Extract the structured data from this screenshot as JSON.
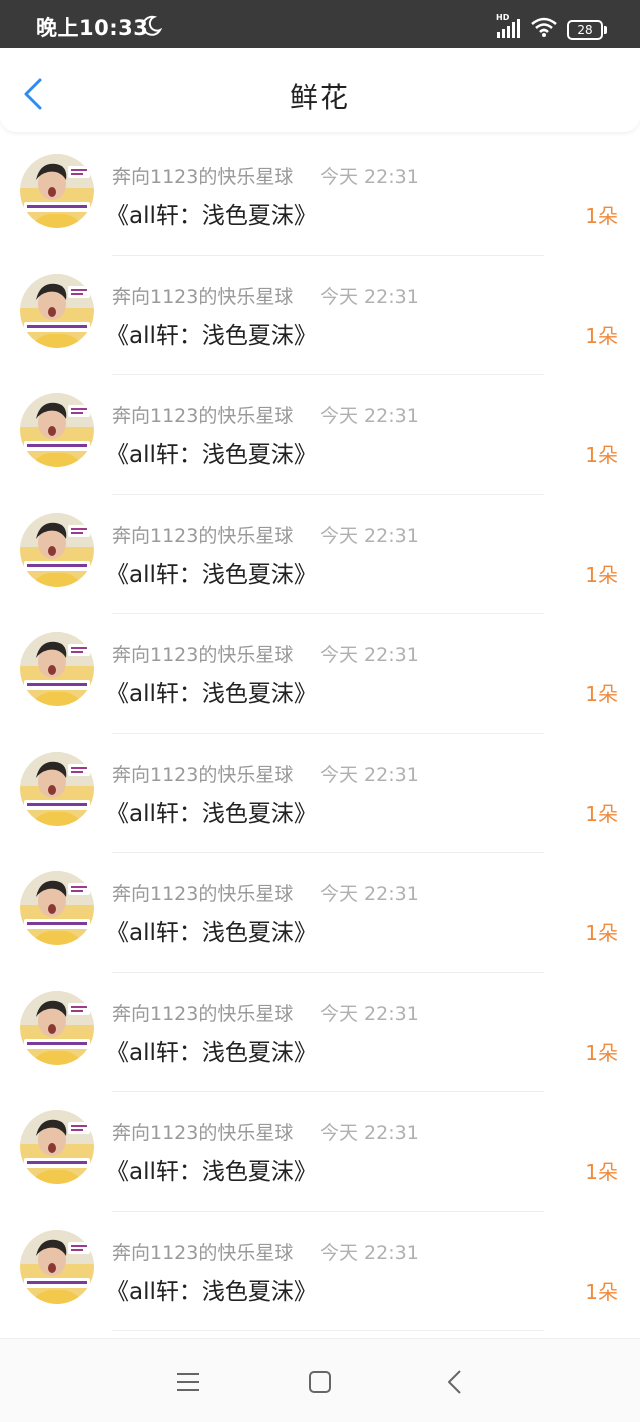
{
  "status_bar": {
    "time": "晚上10:33",
    "network": "HD",
    "battery": "28"
  },
  "header": {
    "title": "鲜花",
    "back_icon": "chevron-left-icon",
    "accent_color": "#2d8cf0"
  },
  "colors": {
    "count": "#f08a3c",
    "secondary_text": "#999999",
    "primary_text": "#222222"
  },
  "items": [
    {
      "user": "奔向1123的快乐星球",
      "time": "今天 22:31",
      "title": "《all轩：浅色夏沫》",
      "count": "1朵"
    },
    {
      "user": "奔向1123的快乐星球",
      "time": "今天 22:31",
      "title": "《all轩：浅色夏沫》",
      "count": "1朵"
    },
    {
      "user": "奔向1123的快乐星球",
      "time": "今天 22:31",
      "title": "《all轩：浅色夏沫》",
      "count": "1朵"
    },
    {
      "user": "奔向1123的快乐星球",
      "time": "今天 22:31",
      "title": "《all轩：浅色夏沫》",
      "count": "1朵"
    },
    {
      "user": "奔向1123的快乐星球",
      "time": "今天 22:31",
      "title": "《all轩：浅色夏沫》",
      "count": "1朵"
    },
    {
      "user": "奔向1123的快乐星球",
      "time": "今天 22:31",
      "title": "《all轩：浅色夏沫》",
      "count": "1朵"
    },
    {
      "user": "奔向1123的快乐星球",
      "time": "今天 22:31",
      "title": "《all轩：浅色夏沫》",
      "count": "1朵"
    },
    {
      "user": "奔向1123的快乐星球",
      "time": "今天 22:31",
      "title": "《all轩：浅色夏沫》",
      "count": "1朵"
    },
    {
      "user": "奔向1123的快乐星球",
      "time": "今天 22:31",
      "title": "《all轩：浅色夏沫》",
      "count": "1朵"
    },
    {
      "user": "奔向1123的快乐星球",
      "time": "今天 22:31",
      "title": "《all轩：浅色夏沫》",
      "count": "1朵"
    }
  ],
  "nav_bar": {
    "icons": [
      "menu-icon",
      "home-square-icon",
      "back-triangle-icon"
    ]
  }
}
